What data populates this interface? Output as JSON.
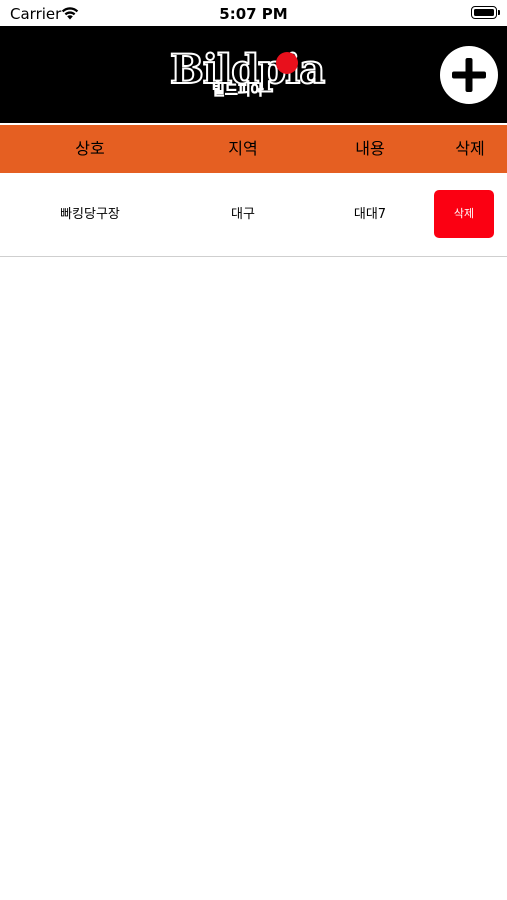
{
  "status_bar": {
    "carrier": "Carrier",
    "time": "5:07 PM",
    "wifi_icon": "wifi-icon",
    "battery_icon": "battery-icon"
  },
  "header": {
    "logo_text": "Bildpia",
    "logo_sub": "빌드피아",
    "add_icon": "plus-circle-icon",
    "background": "#000000"
  },
  "table": {
    "header_color": "#e55f22",
    "columns": [
      "상호",
      "지역",
      "내용",
      "삭제"
    ],
    "rows": [
      {
        "name": "빠킹당구장",
        "region": "대구",
        "content": "대대7",
        "delete_label": "삭제"
      }
    ],
    "delete_button_color": "#fb0012"
  }
}
